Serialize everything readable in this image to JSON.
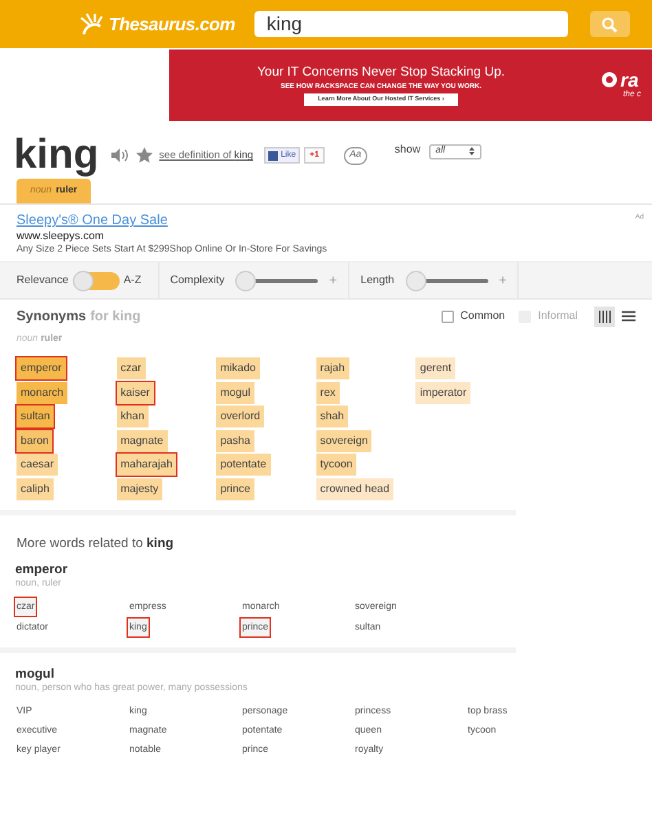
{
  "header": {
    "logo": "Thesaurus.com",
    "search": {
      "value": "king"
    }
  },
  "banner": {
    "headline": "Your IT Concerns Never Stop Stacking Up.",
    "subline": "SEE HOW RACKSPACE CAN CHANGE THE WAY YOU WORK.",
    "cta": "Learn More About Our Hosted IT Services ›",
    "brand": "ra",
    "tagline": "the c"
  },
  "entry": {
    "word": "king",
    "definition_link": {
      "prefix": "see definition of ",
      "word": "king"
    },
    "like": "Like",
    "plus_one": "+1",
    "font_toggle": "Aa",
    "show_label": "show",
    "show_value": "all",
    "senses": [
      {
        "pos": "noun",
        "meaning": "ruler",
        "selected": true
      }
    ]
  },
  "ad": {
    "title": "Sleepy's® One Day Sale",
    "url": "www.sleepys.com",
    "text": "Any Size 2 Piece Sets Start At $299Shop Online Or In-Store For Savings",
    "badge": "Ad"
  },
  "sort_bar": {
    "relevance": "Relevance",
    "az": "A-Z",
    "complexity": "Complexity",
    "length": "Length",
    "plus": "+",
    "plus_2": "+",
    "az_on": false,
    "complexity_slider": {
      "level": 0
    },
    "length_slider": {
      "level": 0
    }
  },
  "synonyms": {
    "title": "Synonyms",
    "subtitle": "for king",
    "filters": [
      {
        "label": "Common",
        "checked": false,
        "disabled": false
      },
      {
        "label": "Informal",
        "checked": false,
        "disabled": true
      }
    ],
    "view_modes": [
      {
        "kind": "columns",
        "selected": true
      },
      {
        "kind": "list",
        "selected": false
      }
    ],
    "sense": {
      "pos": "noun",
      "meaning": "ruler"
    },
    "columns": [
      [
        {
          "word": "emperor",
          "color": "#f7b84a",
          "marked": true
        },
        {
          "word": "monarch",
          "color": "#f7b84a",
          "marked": false
        },
        {
          "word": "sultan",
          "color": "#f7b84a",
          "marked": true
        },
        {
          "word": "baron",
          "color": "#f7c46a",
          "marked": true
        },
        {
          "word": "caesar",
          "color": "#fbd89a",
          "marked": false
        },
        {
          "word": "caliph",
          "color": "#fbd89a",
          "marked": false
        }
      ],
      [
        {
          "word": "czar",
          "color": "#fbd89a",
          "marked": false
        },
        {
          "word": "kaiser",
          "color": "#fbd89a",
          "marked": true
        },
        {
          "word": "khan",
          "color": "#fbd89a",
          "marked": false
        },
        {
          "word": "magnate",
          "color": "#fbd89a",
          "marked": false
        },
        {
          "word": "maharajah",
          "color": "#fbd89a",
          "marked": true
        },
        {
          "word": "majesty",
          "color": "#fbd89a",
          "marked": false
        }
      ],
      [
        {
          "word": "mikado",
          "color": "#fbd89a",
          "marked": false
        },
        {
          "word": "mogul",
          "color": "#fbd89a",
          "marked": false
        },
        {
          "word": "overlord",
          "color": "#fbd89a",
          "marked": false
        },
        {
          "word": "pasha",
          "color": "#fbd89a",
          "marked": false
        },
        {
          "word": "potentate",
          "color": "#fbd89a",
          "marked": false
        },
        {
          "word": "prince",
          "color": "#fbd89a",
          "marked": false
        }
      ],
      [
        {
          "word": "rajah",
          "color": "#fbd89a",
          "marked": false
        },
        {
          "word": "rex",
          "color": "#fbd89a",
          "marked": false
        },
        {
          "word": "shah",
          "color": "#fbd89a",
          "marked": false
        },
        {
          "word": "sovereign",
          "color": "#fbd89a",
          "marked": false
        },
        {
          "word": "tycoon",
          "color": "#fbd89a",
          "marked": false
        },
        {
          "word": "crowned head",
          "color": "#fde6c6",
          "marked": false
        }
      ],
      [
        {
          "word": "gerent",
          "color": "#fde6c6",
          "marked": false
        },
        {
          "word": "imperator",
          "color": "#fde6c6",
          "marked": false
        }
      ]
    ]
  },
  "related": {
    "title_prefix": "More words related to ",
    "title_word": "king",
    "groups": [
      {
        "word": "emperor",
        "sense": "noun, ruler",
        "columns": [
          [
            {
              "word": "czar",
              "marked": true
            },
            {
              "word": "dictator",
              "marked": false
            }
          ],
          [
            {
              "word": "empress",
              "marked": false
            },
            {
              "word": "king",
              "marked": true
            }
          ],
          [
            {
              "word": "monarch",
              "marked": false
            },
            {
              "word": "prince",
              "marked": true
            }
          ],
          [
            {
              "word": "sovereign",
              "marked": false
            },
            {
              "word": "sultan",
              "marked": false
            }
          ]
        ]
      },
      {
        "word": "mogul",
        "sense": "noun, person who has great power, many possessions",
        "columns": [
          [
            {
              "word": "VIP",
              "marked": false
            },
            {
              "word": "executive",
              "marked": false
            },
            {
              "word": "key player",
              "marked": false
            }
          ],
          [
            {
              "word": "king",
              "marked": false
            },
            {
              "word": "magnate",
              "marked": false
            },
            {
              "word": "notable",
              "marked": false
            }
          ],
          [
            {
              "word": "personage",
              "marked": false
            },
            {
              "word": "potentate",
              "marked": false
            },
            {
              "word": "prince",
              "marked": false
            }
          ],
          [
            {
              "word": "princess",
              "marked": false
            },
            {
              "word": "queen",
              "marked": false
            },
            {
              "word": "royalty",
              "marked": false
            }
          ],
          [
            {
              "word": "top brass",
              "marked": false
            },
            {
              "word": "tycoon",
              "marked": false
            }
          ]
        ]
      }
    ]
  }
}
